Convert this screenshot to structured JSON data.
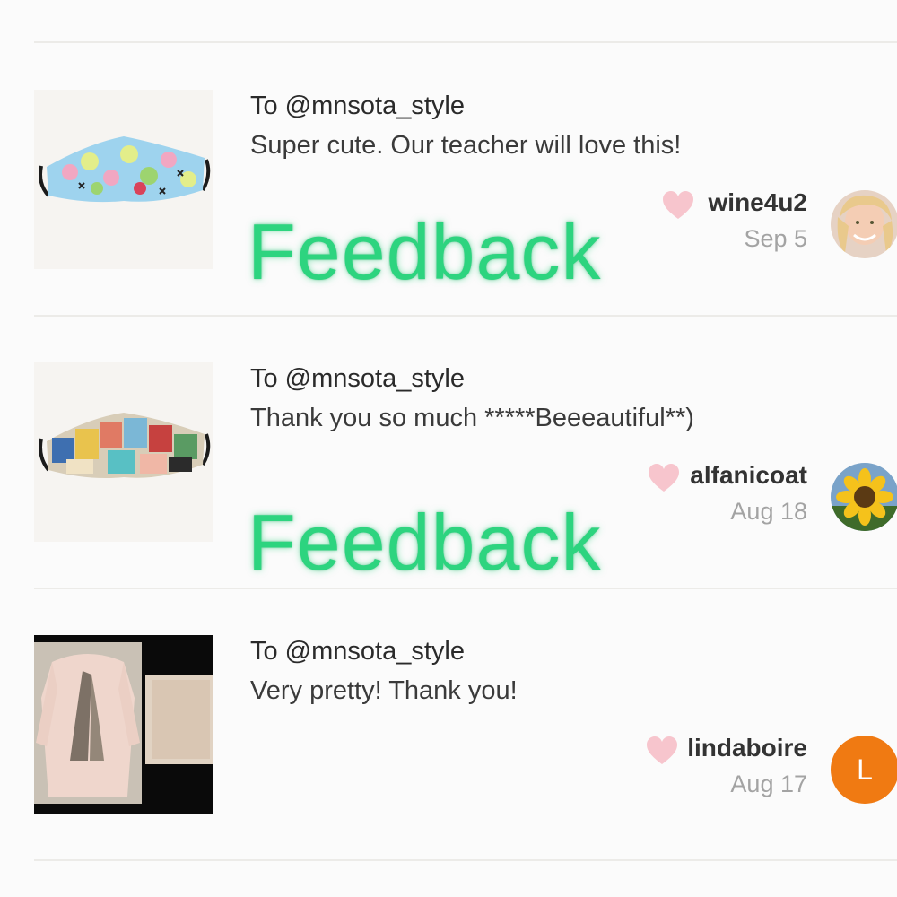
{
  "feedback": [
    {
      "to_label": "To @mnsota_style",
      "message": "Super cute. Our teacher will love this!",
      "username": "wine4u2",
      "date": "Sep 5",
      "watermark": "Feedback",
      "product_icon": "face-mask-fruit-pattern",
      "avatar_icon": "user-photo-avatar"
    },
    {
      "to_label": "To @mnsota_style",
      "message": "Thank you so much *****Beeeautiful**)",
      "username": "alfanicoat",
      "date": "Aug 18",
      "watermark": "Feedback",
      "product_icon": "face-mask-comic-pattern",
      "avatar_icon": "sunflower-avatar"
    },
    {
      "to_label": "To @mnsota_style",
      "message": "Very pretty! Thank you!",
      "username": "lindaboire",
      "date": "Aug 17",
      "avatar_letter": "L",
      "product_icon": "pink-sweater-photo",
      "avatar_icon": "letter-avatar"
    }
  ],
  "colors": {
    "watermark_green": "#2dd47f",
    "heart_pink": "#f7c5cd",
    "avatar_orange": "#f07a12",
    "divider": "#ecebe8"
  }
}
